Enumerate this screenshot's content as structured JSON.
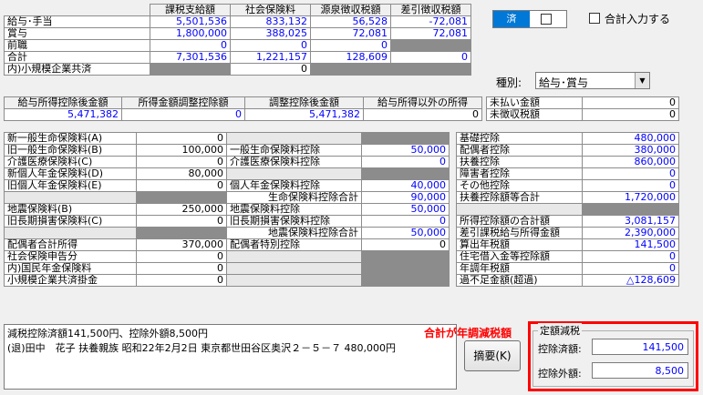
{
  "income": {
    "columns": [
      "課税支給額",
      "社会保険料",
      "源泉徴収税額",
      "差引徴収税額"
    ],
    "rows": [
      {
        "label": "給与･手当",
        "v": [
          "5,501,536",
          "833,132",
          "56,528",
          "-72,081"
        ]
      },
      {
        "label": "賞与",
        "v": [
          "1,800,000",
          "388,025",
          "72,081",
          "72,081"
        ]
      },
      {
        "label": "前職",
        "v": [
          "0",
          "0",
          "0",
          ""
        ]
      },
      {
        "label": "合計",
        "v": [
          "7,301,536",
          "1,221,157",
          "128,609",
          "0"
        ]
      },
      {
        "label": "内)小規模企業共済",
        "v": [
          "",
          "0",
          "",
          ""
        ]
      }
    ]
  },
  "deduction_summary": {
    "headers": [
      "給与所得控除後金額",
      "所得金額調整控除額",
      "調整控除後金額",
      "給与所得以外の所得"
    ],
    "values": [
      "5,471,382",
      "0",
      "5,471,382",
      "0"
    ]
  },
  "top_right": {
    "done_label": "済",
    "total_input_label": "合計入力する",
    "type_label": "種別:",
    "type_value": "給与･賞与",
    "unpaid_label": "未払い金額",
    "unpaid_value": "0",
    "uncollected_label": "未徴収税額",
    "uncollected_value": "0"
  },
  "insurance_left": [
    {
      "label": "新一般生命保険料(A)",
      "value": "0"
    },
    {
      "label": "旧一般生命保険料(B)",
      "value": "100,000"
    },
    {
      "label": "介護医療保険料(C)",
      "value": "0"
    },
    {
      "label": "新個人年金保険料(D)",
      "value": "80,000"
    },
    {
      "label": "旧個人年金保険料(E)",
      "value": "0"
    },
    {
      "label": "",
      "value": ""
    },
    {
      "label": "地震保険料(B)",
      "value": "250,000"
    },
    {
      "label": "旧長期損害保険料(C)",
      "value": "0"
    },
    {
      "label": "",
      "value": ""
    },
    {
      "label": "配偶者合計所得",
      "value": "370,000"
    },
    {
      "label": "社会保険申告分",
      "value": "0"
    },
    {
      "label": "内)国民年金保険料",
      "value": "0"
    },
    {
      "label": "小規模企業共済掛金",
      "value": "0"
    }
  ],
  "insurance_mid": [
    {
      "label": "",
      "value": ""
    },
    {
      "label": "一般生命保険料控除",
      "value": "50,000"
    },
    {
      "label": "介護医療保険料控除",
      "value": "0"
    },
    {
      "label": "",
      "value": ""
    },
    {
      "label": "個人年金保険料控除",
      "value": "40,000"
    },
    {
      "label": "生命保険料控除合計",
      "value": "90,000"
    },
    {
      "label": "地震保険料控除",
      "value": "50,000"
    },
    {
      "label": "旧長期損害保険料控除",
      "value": "0"
    },
    {
      "label": "地震保険料控除合計",
      "value": "50,000"
    },
    {
      "label": "配偶者特別控除",
      "value": "0"
    },
    {
      "label": "",
      "value": ""
    },
    {
      "label": "",
      "value": ""
    },
    {
      "label": "",
      "value": ""
    }
  ],
  "right_table": [
    {
      "label": "基礎控除",
      "value": "480,000"
    },
    {
      "label": "配偶者控除",
      "value": "380,000"
    },
    {
      "label": "扶養控除",
      "value": "860,000"
    },
    {
      "label": "障害者控除",
      "value": "0"
    },
    {
      "label": "その他控除",
      "value": "0"
    },
    {
      "label": "扶養控除額等合計",
      "value": "1,720,000"
    },
    {
      "label": "",
      "value": ""
    },
    {
      "label": "所得控除額の合計額",
      "value": "3,081,157"
    },
    {
      "label": "差引課税給与所得金額",
      "value": "2,390,000"
    },
    {
      "label": "算出年税額",
      "value": "141,500"
    },
    {
      "label": "住宅借入金等控除額",
      "value": "0"
    },
    {
      "label": "年調年税額",
      "value": "0"
    },
    {
      "label": "過不足金額(超過)",
      "value": "△128,609"
    }
  ],
  "summary": {
    "line1": "減税控除済額141,500円、控除外額8,500円",
    "line2": "(退)田中　花子 扶養親族 昭和22年2月2日 東京都世田谷区奥沢２－５－７ 480,000円",
    "annotation": "合計が年調減税額",
    "abstract_button": "摘要(K)"
  },
  "fixed_reduction": {
    "title": "定額減税",
    "deducted_label": "控除済額:",
    "deducted_value": "141,500",
    "excluded_label": "控除外額:",
    "excluded_value": "8,500"
  },
  "colors": {
    "accent_blue": "#0000ff",
    "highlight_red": "#ff0000",
    "selected_blue": "#0078d7"
  }
}
